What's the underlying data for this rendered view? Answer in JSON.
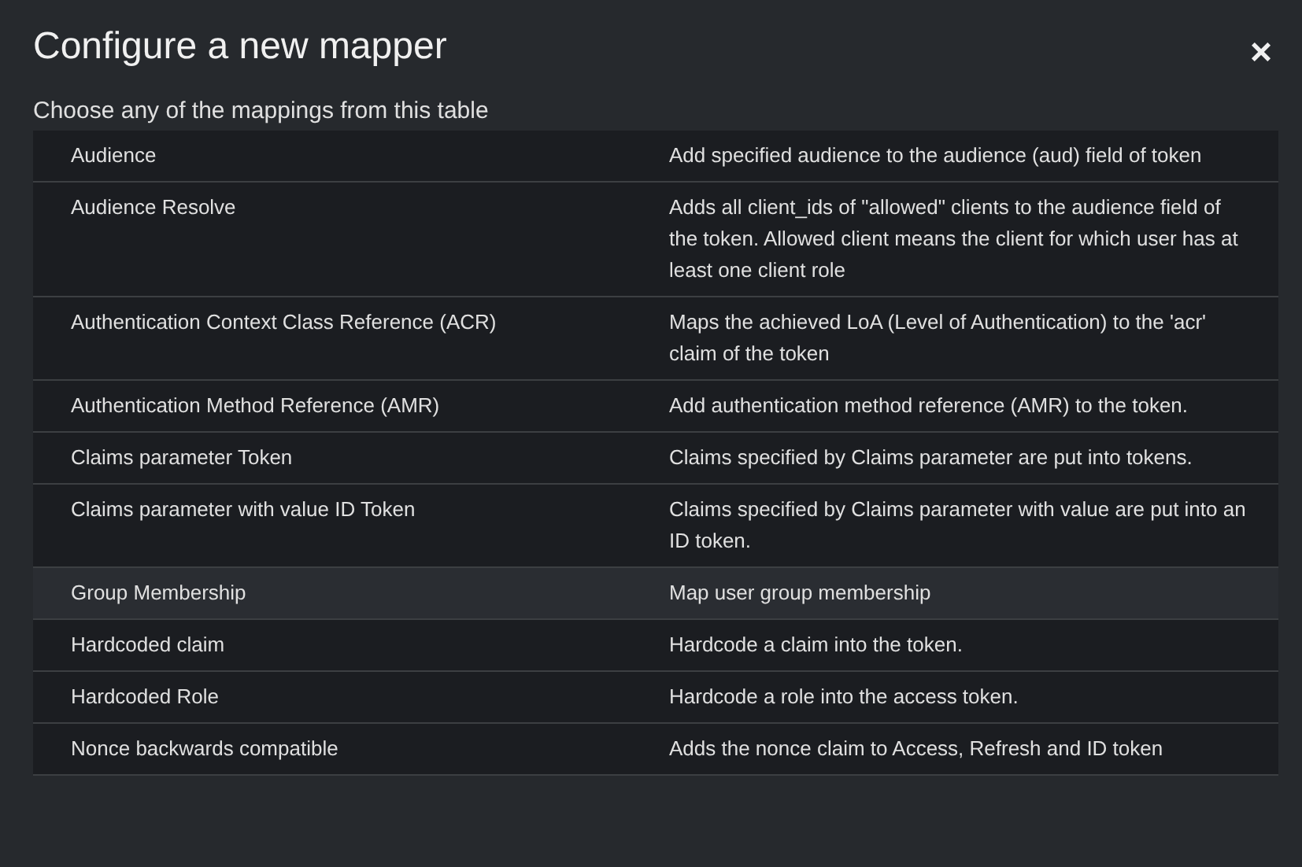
{
  "dialog": {
    "title": "Configure a new mapper",
    "close": "×",
    "subtitle": "Choose any of the mappings from this table"
  },
  "rows": [
    {
      "name": "Audience",
      "description": "Add specified audience to the audience (aud) field of token",
      "hovered": false
    },
    {
      "name": "Audience Resolve",
      "description": "Adds all client_ids of \"allowed\" clients to the audience field of the token. Allowed client means the client for which user has at least one client role",
      "hovered": false
    },
    {
      "name": "Authentication Context Class Reference (ACR)",
      "description": "Maps the achieved LoA (Level of Authentication) to the 'acr' claim of the token",
      "hovered": false
    },
    {
      "name": "Authentication Method Reference (AMR)",
      "description": "Add authentication method reference (AMR) to the token.",
      "hovered": false
    },
    {
      "name": "Claims parameter Token",
      "description": "Claims specified by Claims parameter are put into tokens.",
      "hovered": false
    },
    {
      "name": "Claims parameter with value ID Token",
      "description": "Claims specified by Claims parameter with value are put into an ID token.",
      "hovered": false
    },
    {
      "name": "Group Membership",
      "description": "Map user group membership",
      "hovered": true
    },
    {
      "name": "Hardcoded claim",
      "description": "Hardcode a claim into the token.",
      "hovered": false
    },
    {
      "name": "Hardcoded Role",
      "description": "Hardcode a role into the access token.",
      "hovered": false
    },
    {
      "name": "Nonce backwards compatible",
      "description": "Adds the nonce claim to Access, Refresh and ID token",
      "hovered": false
    }
  ]
}
